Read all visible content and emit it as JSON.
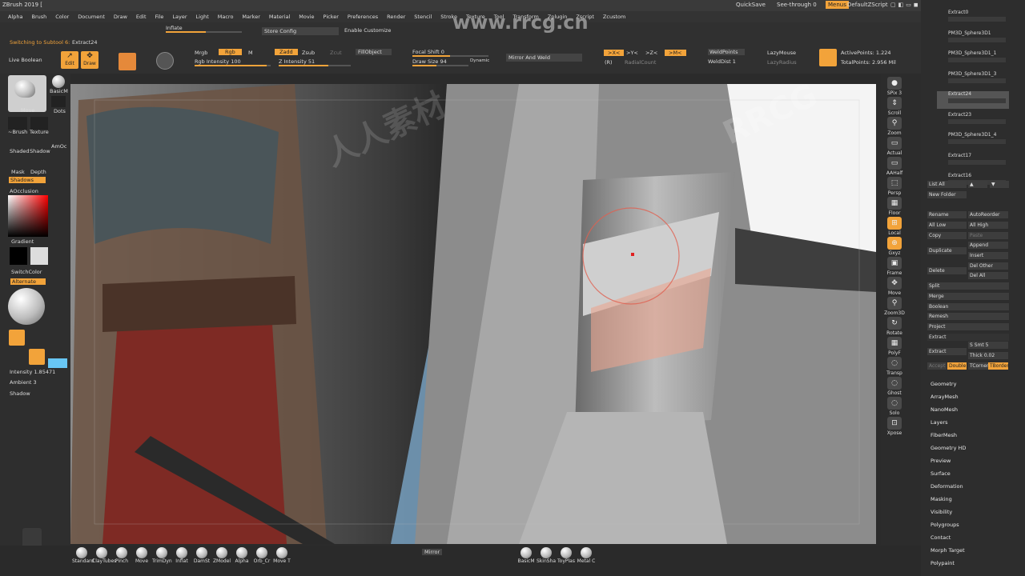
{
  "app": {
    "title": "ZBrush 2019 [",
    "quicksave": "QuickSave",
    "see_through": "See-through  0",
    "menus_btn": "Menus",
    "script": "DefaultZScript"
  },
  "menus": [
    "Alpha",
    "Brush",
    "Color",
    "Document",
    "Draw",
    "Edit",
    "File",
    "Layer",
    "Light",
    "Macro",
    "Marker",
    "Material",
    "Movie",
    "Picker",
    "Preferences",
    "Render",
    "Stencil",
    "Stroke",
    "Texture",
    "Tool",
    "Transform",
    "Zplugin",
    "Zscript",
    "Zcustom"
  ],
  "toolbar": {
    "subtool_msg": "Switching to Subtool 6:",
    "subtool_name": "Extract24",
    "live_boolean": "Live Boolean",
    "edit": "Edit",
    "draw": "Draw",
    "inflate": "Inflate",
    "store_config": "Store Config",
    "enable_customize": "Enable Customize",
    "mrgb": "Mrgb",
    "rgb": "Rgb",
    "m": "M",
    "zadd": "Zadd",
    "zsub": "Zsub",
    "zcut": "Zcut",
    "rgb_intensity": "Rgb Intensity 100",
    "z_intensity": "Z Intensity 51",
    "fill_object": "FillObject",
    "focal_shift": "Focal Shift 0",
    "draw_size": "Draw Size 94",
    "dynamic": "Dynamic",
    "mirror_weld": "Mirror And Weld",
    "x": ">X<",
    "y": ">Y<",
    "z": ">Z<",
    "m2": ">M<",
    "r": "(R)",
    "radial_count": "RadialCount",
    "weld_points": "WeldPoints",
    "weld_dist": "WeldDist 1",
    "lazy_mouse": "LazyMouse",
    "lazy_radius": "LazyRadius",
    "active_points": "ActivePoints: 1.224",
    "total_points": "TotalPoints: 2.956 Mil"
  },
  "left": {
    "move": "Move",
    "basic": "BasicM",
    "dots": "Dots",
    "brush": "~Brush",
    "texture": "Texture",
    "shaded": "Shaded",
    "shadow": "Shadow",
    "amoc": "AmOc",
    "mask": "Mask",
    "depth": "Depth",
    "shadows": "Shadows",
    "aocclusion": "AOcclusion",
    "gradient": "Gradient",
    "switch_color": "SwitchColor",
    "alternate": "Alternate",
    "intensity": "Intensity 1.85471",
    "ambient": "Ambient 3",
    "shadow2": "Shadow"
  },
  "right_shelf": [
    "SPix 3",
    "Scroll",
    "Zoom",
    "Actual",
    "AAHalf",
    "Persp",
    "Floor",
    "Local",
    "Gxyz",
    "Frame",
    "Move",
    "Zoom3D",
    "Rotate",
    "PolyF",
    "Transp",
    "Ghost",
    "Solo",
    "Xpose"
  ],
  "subtools": [
    {
      "name": "Extract0"
    },
    {
      "name": "PM3D_Sphere3D1"
    },
    {
      "name": "PM3D_Sphere3D1_1"
    },
    {
      "name": "PM3D_Sphere3D1_3"
    },
    {
      "name": "Extract24"
    },
    {
      "name": "Extract23"
    },
    {
      "name": "PM3D_Sphere3D1_4"
    },
    {
      "name": "Extract17"
    },
    {
      "name": "Extract16"
    }
  ],
  "rpanel": {
    "list_all": "List All",
    "new_folder": "New Folder",
    "rename": "Rename",
    "auto_reorder": "AutoReorder",
    "all_low": "All Low",
    "all_high": "All High",
    "copy": "Copy",
    "paste": "Paste",
    "append": "Append",
    "duplicate": "Duplicate",
    "insert": "Insert",
    "delete": "Delete",
    "del_other": "Del Other",
    "del_all": "Del All",
    "split": "Split",
    "merge": "Merge",
    "boolean": "Boolean",
    "remesh": "Remesh",
    "project": "Project",
    "extract_head": "Extract",
    "extract": "Extract",
    "s_smt": "S Smt 5",
    "thick": "Thick 0.02",
    "accept": "Accept",
    "double": "Double",
    "tcorner": "TCorner",
    "tborder": "TBorder",
    "sections": [
      "Geometry",
      "ArrayMesh",
      "NanoMesh",
      "Layers",
      "FiberMesh",
      "Geometry HD",
      "Preview",
      "Surface",
      "Deformation",
      "Masking",
      "Visibility",
      "Polygroups",
      "Contact",
      "Morph Target",
      "Polypaint"
    ]
  },
  "bottom": {
    "brushes": [
      "Standard",
      "ClayTubes",
      "Pinch",
      "Move",
      "TrimDyn",
      "Inflat",
      "DamSt",
      "ZModel",
      "Alpha",
      "Orb_Cr",
      "Move T"
    ],
    "mirror": "Mirror",
    "materials": [
      "BasicM",
      "SkinSha",
      "ToyPlas",
      "Metal C"
    ]
  },
  "watermark": {
    "brand": "RRCG",
    "cn": "人人素材",
    "url": "www.rrcg.cn"
  }
}
